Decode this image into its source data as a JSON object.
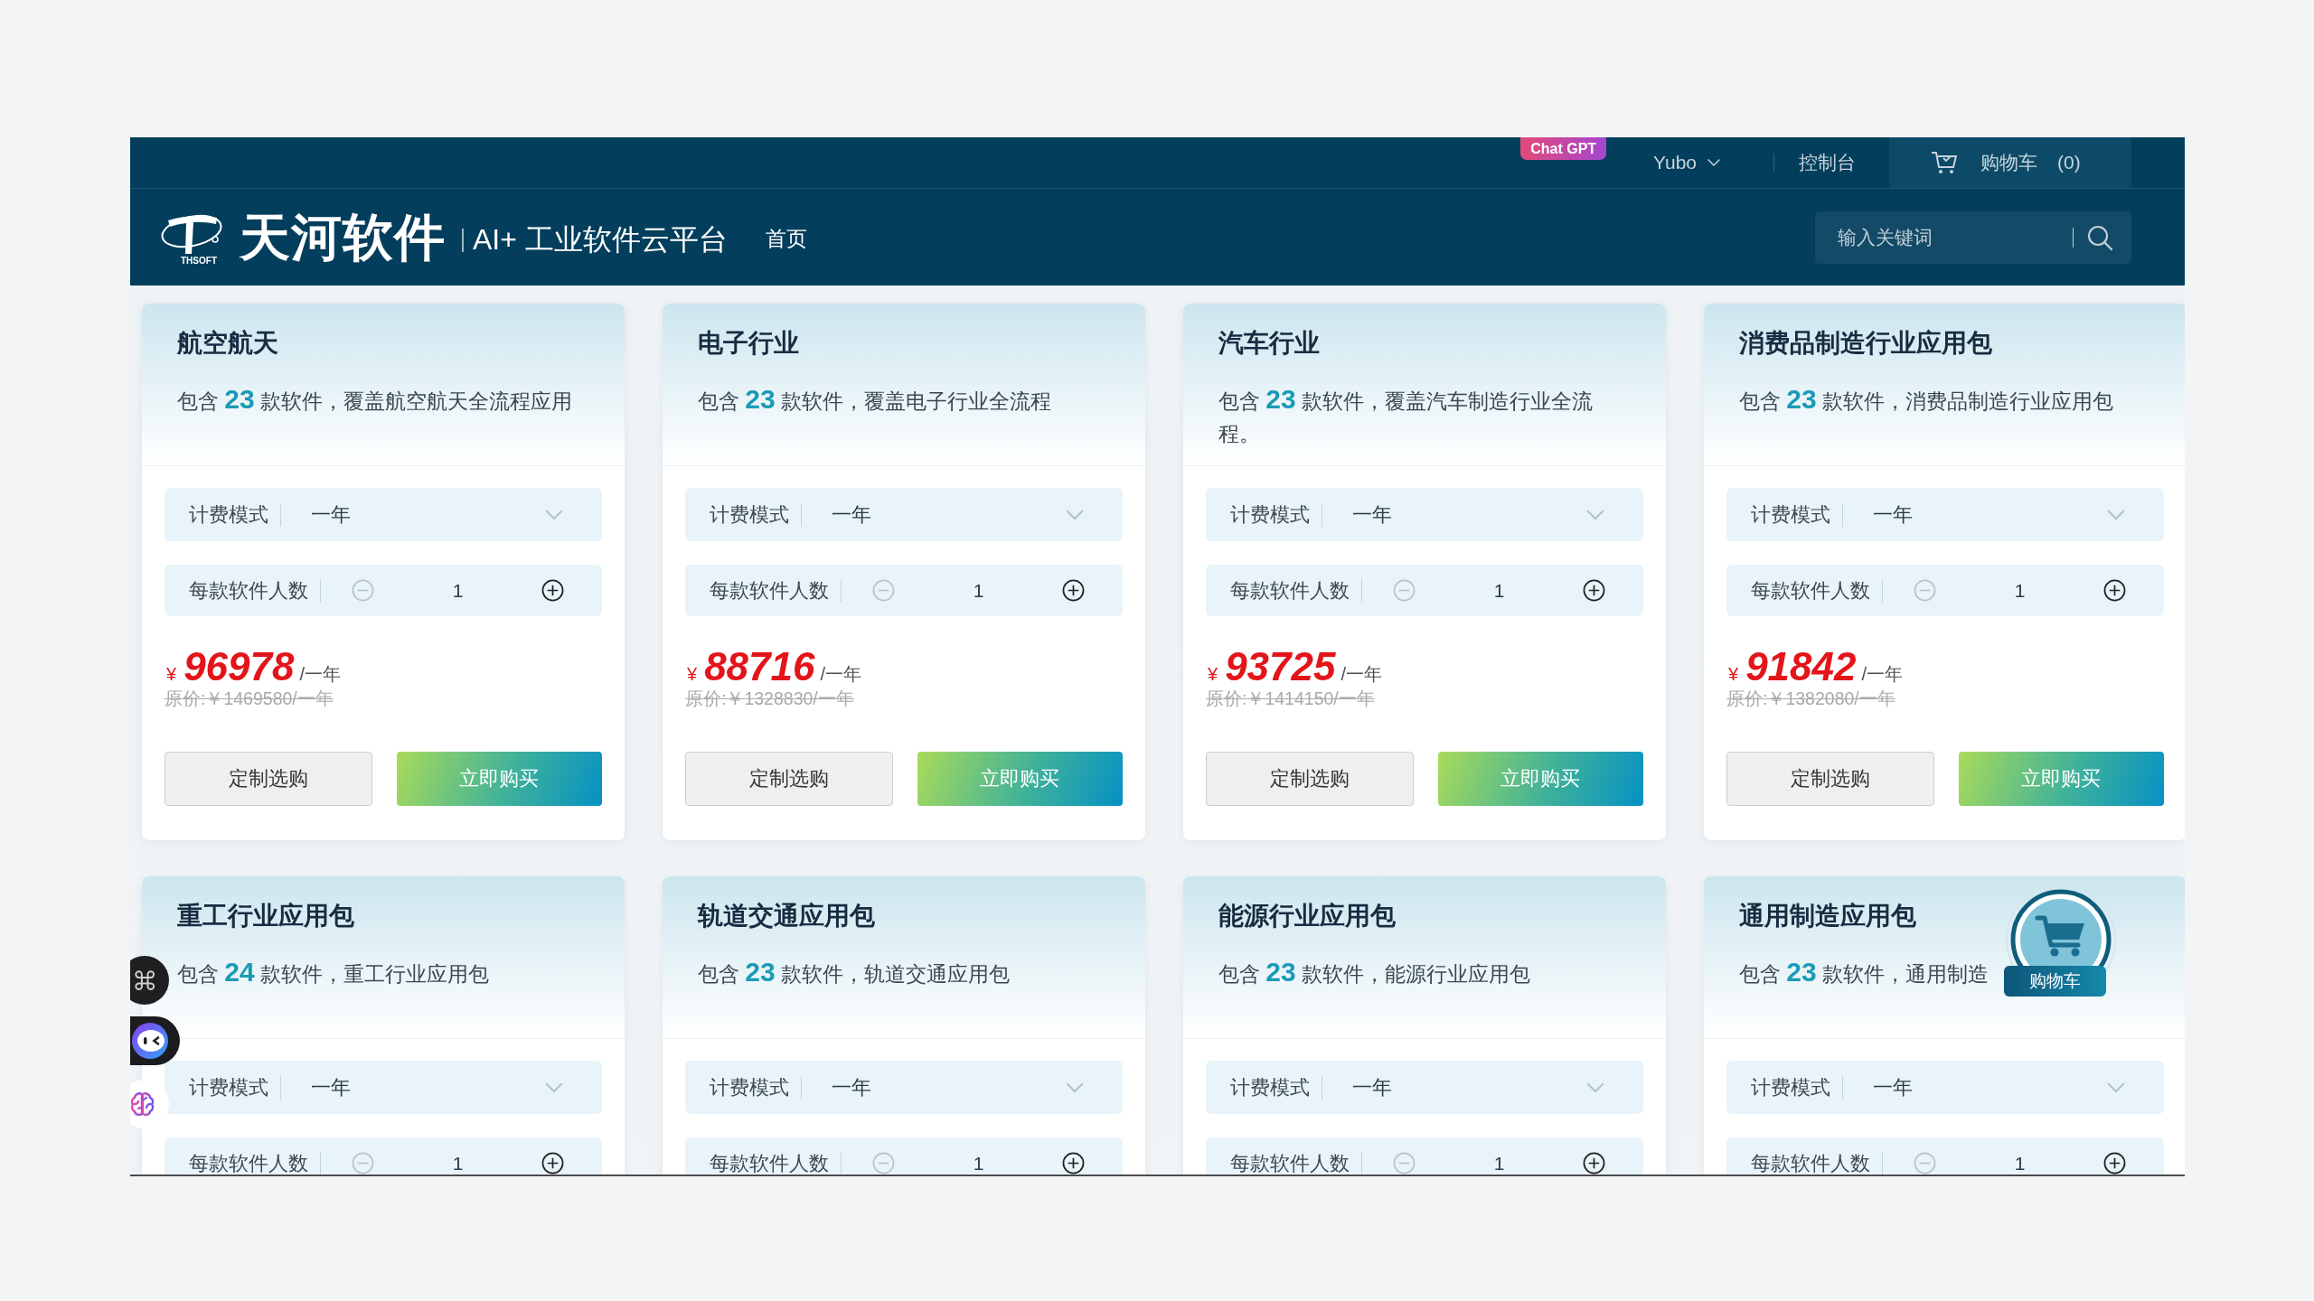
{
  "top_bar": {
    "badge": "Chat GPT",
    "user": "Yubo",
    "console": "控制台",
    "cart": {
      "label": "购物车",
      "count": "(0)"
    }
  },
  "header": {
    "logo_text": "THSOFT",
    "brand": "天河软件",
    "tagline": "AI+ 工业软件云平台",
    "nav": [
      "首页"
    ],
    "search": {
      "placeholder": "输入关键词"
    }
  },
  "cards": [
    {
      "title": "航空航天",
      "description": "包含 **23** 款软件，覆盖航空航天全流程应用",
      "billing": {
        "label": "计费模式",
        "value": "一年"
      },
      "seats": {
        "label": "每款软件人数",
        "value": "1",
        "minus_disabled": true
      },
      "price": {
        "currency": "¥",
        "amount": "96978",
        "unit": "/一年",
        "original": "原价:￥1469580/一年"
      },
      "buttons": [
        {
          "label": "定制选购",
          "kind": "secondary"
        },
        {
          "label": "立即购买",
          "kind": "primary"
        }
      ]
    },
    {
      "title": "电子行业",
      "description": "包含 **23** 款软件，覆盖电子行业全流程",
      "billing": {
        "label": "计费模式",
        "value": "一年"
      },
      "seats": {
        "label": "每款软件人数",
        "value": "1",
        "minus_disabled": true
      },
      "price": {
        "currency": "¥",
        "amount": "88716",
        "unit": "/一年",
        "original": "原价:￥1328830/一年"
      },
      "buttons": [
        {
          "label": "定制选购",
          "kind": "secondary"
        },
        {
          "label": "立即购买",
          "kind": "primary"
        }
      ]
    },
    {
      "title": "汽车行业",
      "description": "包含 **23** 款软件，覆盖汽车制造行业全流程。",
      "billing": {
        "label": "计费模式",
        "value": "一年"
      },
      "seats": {
        "label": "每款软件人数",
        "value": "1",
        "minus_disabled": true
      },
      "price": {
        "currency": "¥",
        "amount": "93725",
        "unit": "/一年",
        "original": "原价:￥1414150/一年"
      },
      "buttons": [
        {
          "label": "定制选购",
          "kind": "secondary"
        },
        {
          "label": "立即购买",
          "kind": "primary"
        }
      ]
    },
    {
      "title": "消费品制造行业应用包",
      "description": "包含 **23** 款软件，消费品制造行业应用包",
      "billing": {
        "label": "计费模式",
        "value": "一年"
      },
      "seats": {
        "label": "每款软件人数",
        "value": "1",
        "minus_disabled": true
      },
      "price": {
        "currency": "¥",
        "amount": "91842",
        "unit": "/一年",
        "original": "原价:￥1382080/一年"
      },
      "buttons": [
        {
          "label": "定制选购",
          "kind": "secondary"
        },
        {
          "label": "立即购买",
          "kind": "primary"
        }
      ]
    },
    {
      "title": "重工行业应用包",
      "description": "包含 **24** 款软件，重工行业应用包",
      "billing": {
        "label": "计费模式",
        "value": "一年"
      },
      "seats": {
        "label": "每款软件人数",
        "value": "1",
        "minus_disabled": true
      }
    },
    {
      "title": "轨道交通应用包",
      "description": "包含 **23** 款软件，轨道交通应用包",
      "billing": {
        "label": "计费模式",
        "value": "一年"
      },
      "seats": {
        "label": "每款软件人数",
        "value": "1",
        "minus_disabled": true
      }
    },
    {
      "title": "能源行业应用包",
      "description": "包含 **23** 款软件，能源行业应用包",
      "billing": {
        "label": "计费模式",
        "value": "一年"
      },
      "seats": {
        "label": "每款软件人数",
        "value": "1",
        "minus_disabled": true
      }
    },
    {
      "title": "通用制造应用包",
      "description": "包含 **23** 款软件，通用制造",
      "billing": {
        "label": "计费模式",
        "value": "一年"
      },
      "seats": {
        "label": "每款软件人数",
        "value": "1",
        "minus_disabled": true
      }
    }
  ],
  "floating_cart": {
    "label": "购物车"
  }
}
